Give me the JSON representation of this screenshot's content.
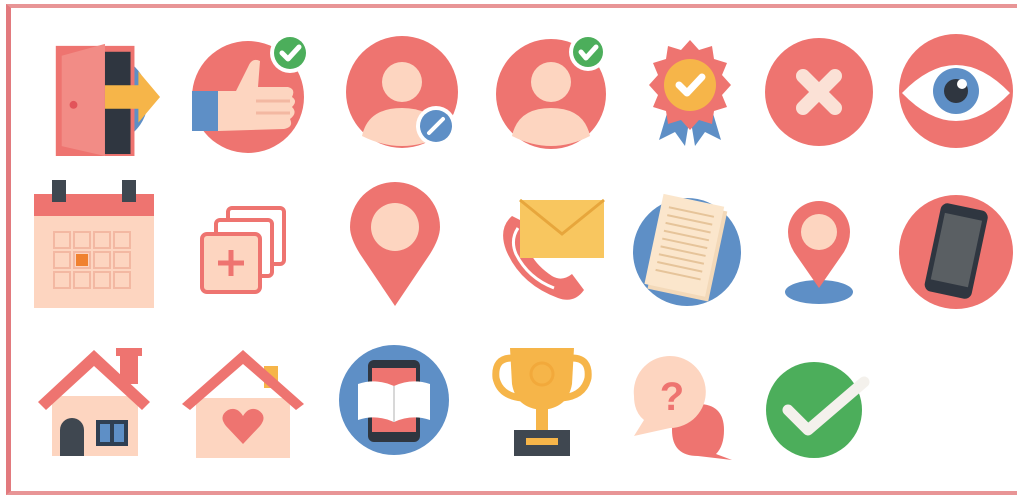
{
  "icons": [
    {
      "name": "exit-door-icon"
    },
    {
      "name": "thumbs-up-approved-icon"
    },
    {
      "name": "edit-user-icon"
    },
    {
      "name": "verified-user-icon"
    },
    {
      "name": "award-badge-icon"
    },
    {
      "name": "close-icon"
    },
    {
      "name": "eye-icon"
    },
    {
      "name": "calendar-icon"
    },
    {
      "name": "add-layers-icon"
    },
    {
      "name": "map-pin-icon"
    },
    {
      "name": "phone-mail-icon"
    },
    {
      "name": "document-icon"
    },
    {
      "name": "location-marker-icon"
    },
    {
      "name": "smartphone-icon"
    },
    {
      "name": "home-icon"
    },
    {
      "name": "favorite-home-icon"
    },
    {
      "name": "ebook-icon"
    },
    {
      "name": "trophy-icon"
    },
    {
      "name": "help-chat-icon"
    },
    {
      "name": "check-icon"
    }
  ],
  "text": {
    "question_mark": "?"
  },
  "colors": {
    "coral": "#ee7470",
    "skin": "#fdd5c0",
    "blue": "#5e8fc6",
    "green": "#4cae5b",
    "gold": "#f6c15a",
    "dark": "#3f4750"
  }
}
